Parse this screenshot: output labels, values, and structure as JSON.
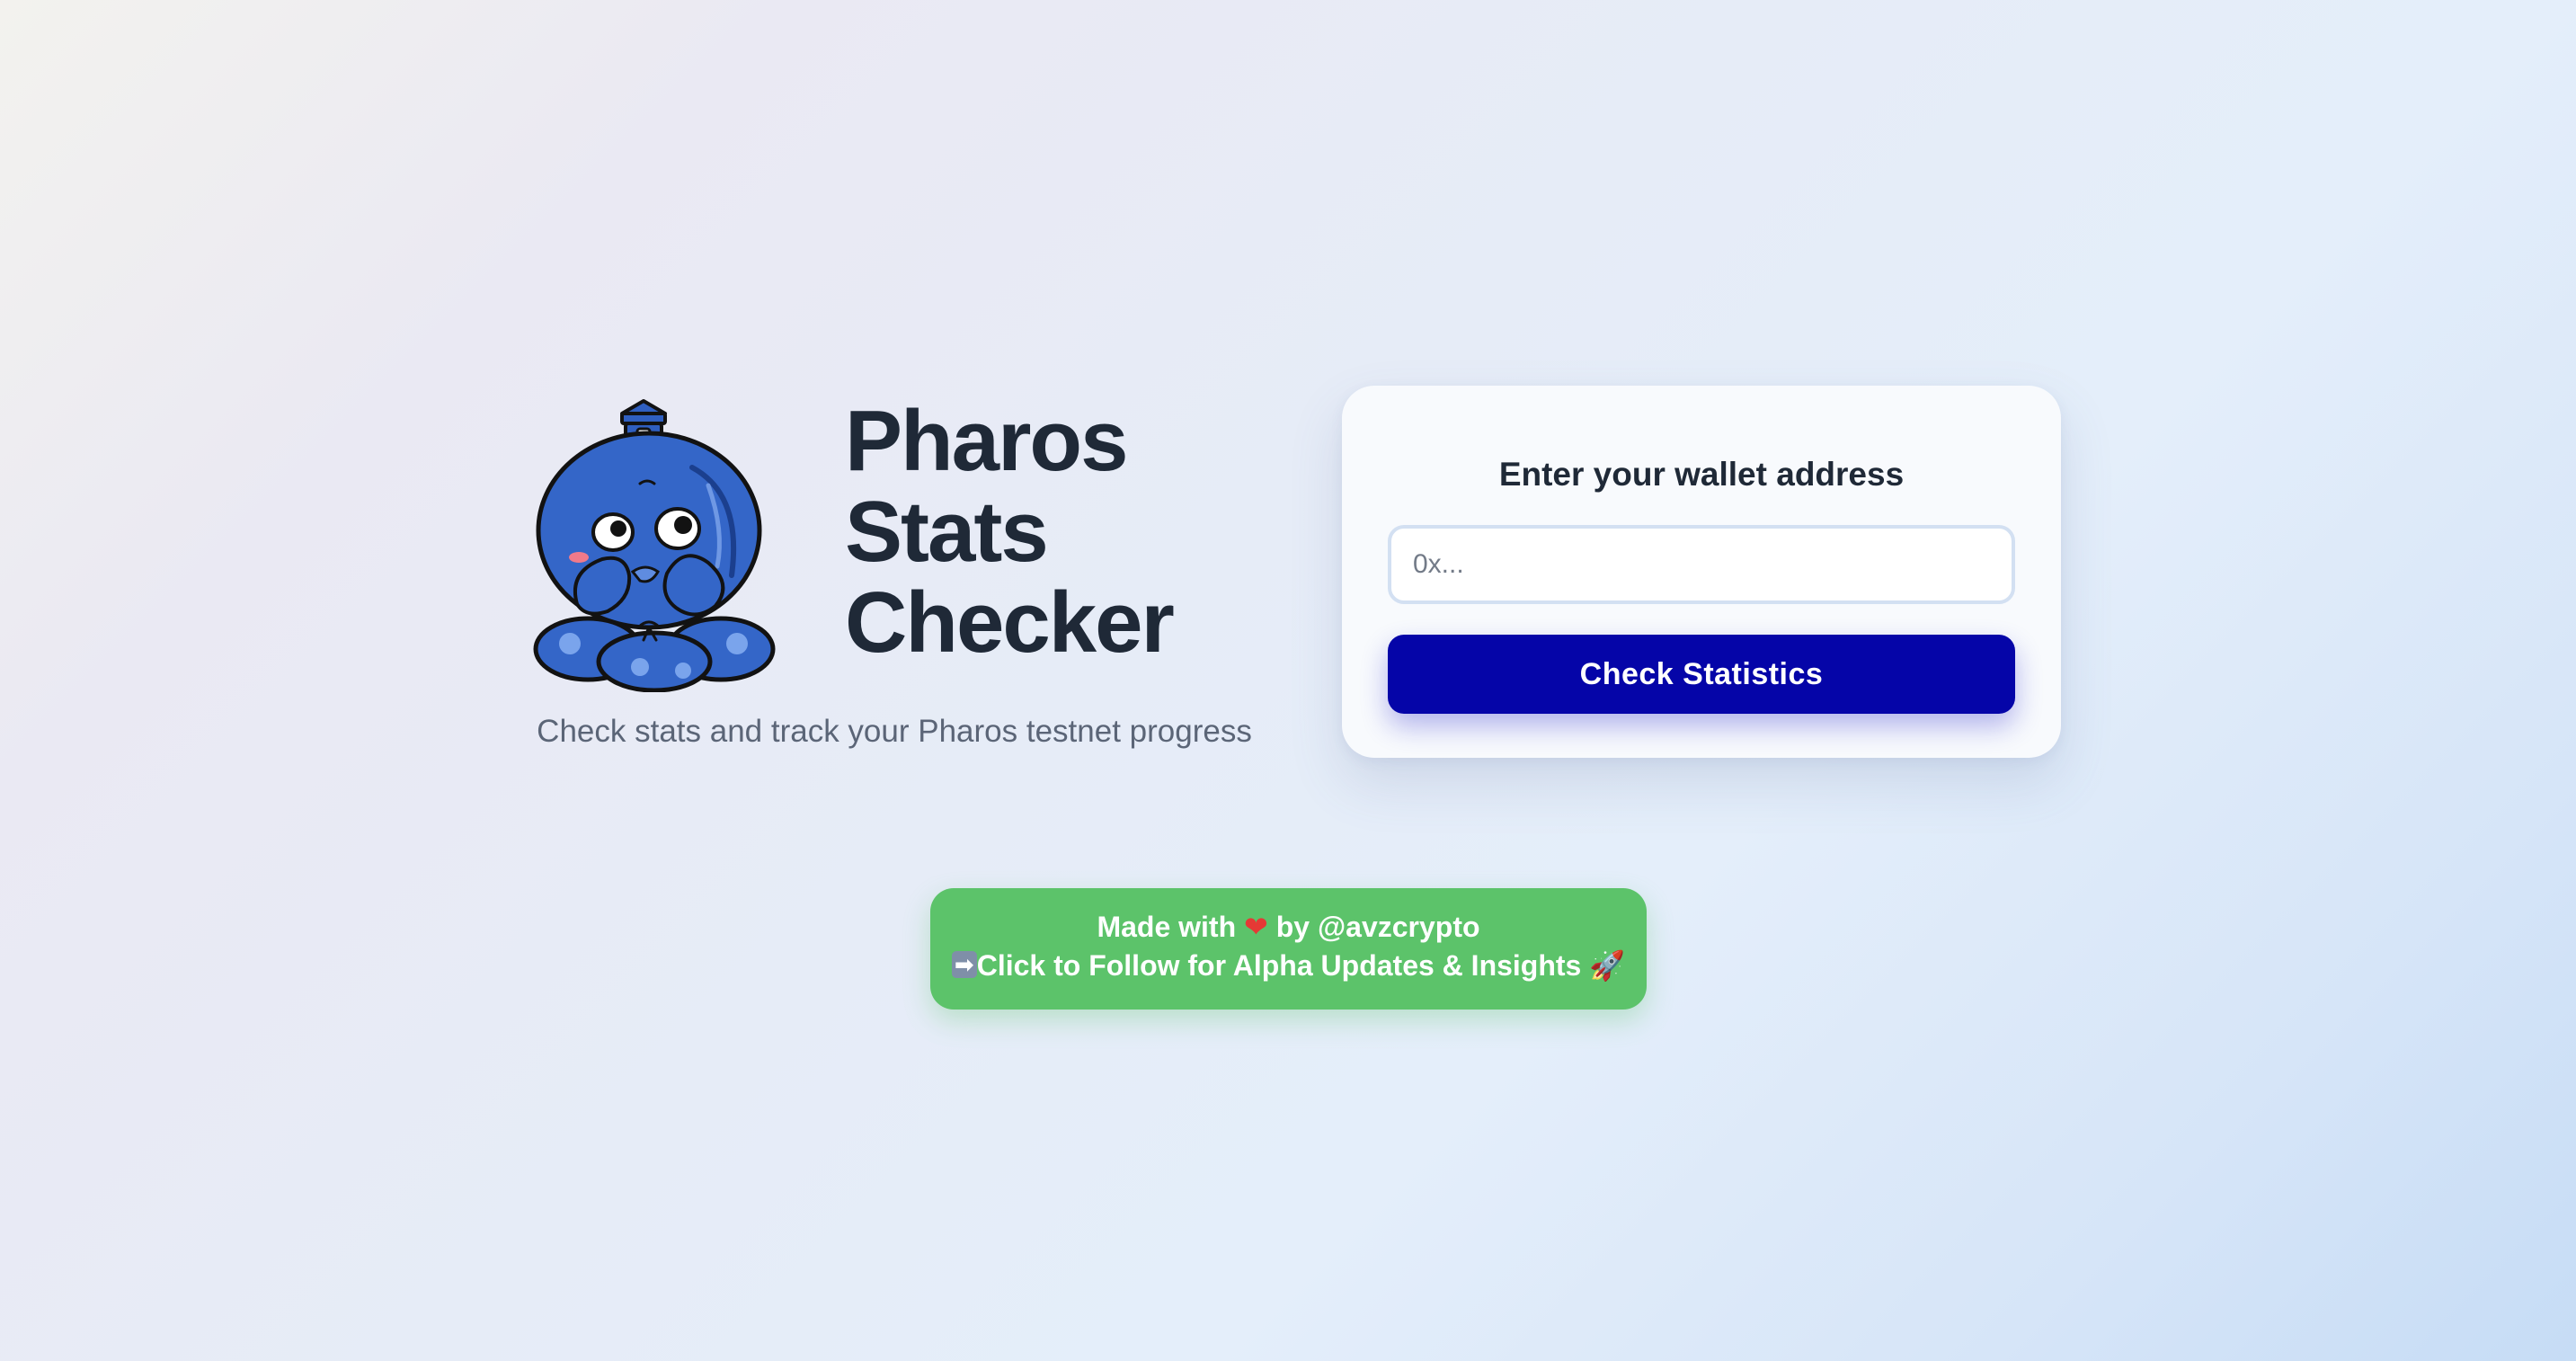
{
  "hero": {
    "title_lines": [
      "Pharos",
      "Stats",
      "Checker"
    ],
    "subtitle": "Check stats and track your Pharos testnet progress",
    "mascot_icon": "blue-octopus-lighthouse-mascot"
  },
  "wallet_form": {
    "heading": "Enter your wallet address",
    "input_value": "",
    "input_placeholder": "0x...",
    "submit_label": "Check Statistics"
  },
  "footer_banner": {
    "line1_prefix": "Made with",
    "line1_icon": "heart-icon",
    "line1_suffix": "by @avzcrypto",
    "line2_icon": "right-arrow-icon",
    "line2_text": "Click to Follow for Alpha Updates & Insights",
    "line2_trailing_icon": "rocket-icon"
  },
  "colors": {
    "title_text": "#1f2937",
    "subtitle_text": "#5b6577",
    "button_primary": "#0505a8",
    "banner_green": "#5cc36a",
    "mascot_blue": "#3466c8"
  }
}
